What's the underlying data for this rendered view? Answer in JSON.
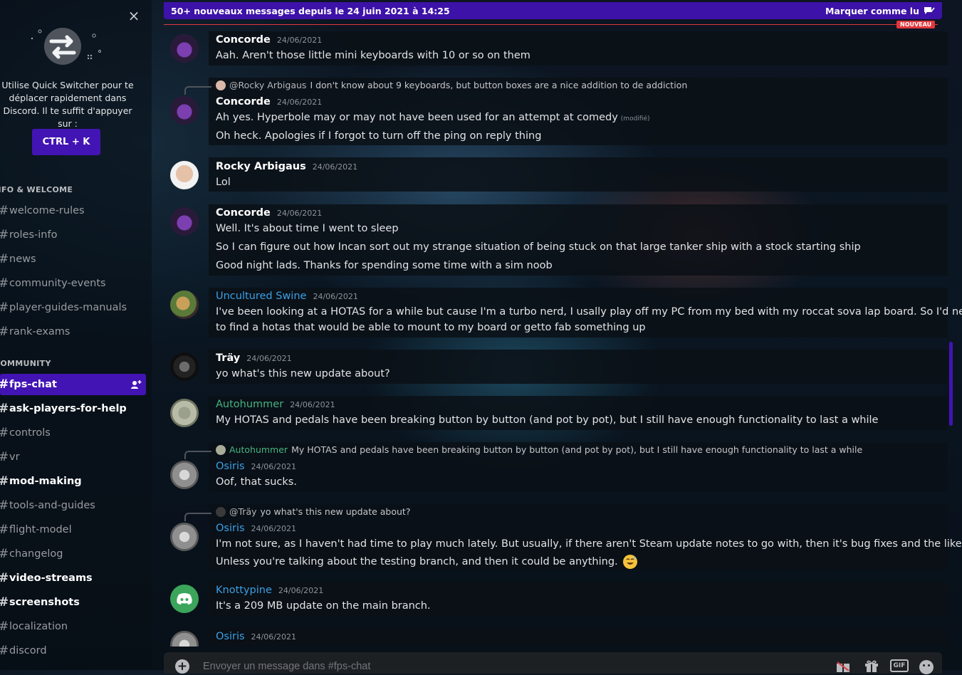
{
  "sidebar": {
    "close_glyph": "×",
    "quick_switcher_text": "Utilise Quick Switcher pour te déplacer rapidement dans Discord. Il te suffit d'appuyer sur :",
    "shortcut_button": "CTRL + K",
    "categories": [
      {
        "label": "INFO & WELCOME"
      },
      {
        "label": "COMMUNITY"
      }
    ],
    "channels": [
      {
        "name": "welcome-rules",
        "bold": false
      },
      {
        "name": "roles-info",
        "bold": false
      },
      {
        "name": "news",
        "bold": false
      },
      {
        "name": "community-events",
        "bold": false
      },
      {
        "name": "player-guides-manuals",
        "bold": false
      },
      {
        "name": "rank-exams",
        "bold": false
      },
      {
        "name": "fps-chat",
        "active": true
      },
      {
        "name": "ask-players-for-help",
        "bold": true
      },
      {
        "name": "controls",
        "bold": false
      },
      {
        "name": "vr",
        "bold": false
      },
      {
        "name": "mod-making",
        "bold": true
      },
      {
        "name": "tools-and-guides",
        "bold": false
      },
      {
        "name": "flight-model",
        "bold": false
      },
      {
        "name": "changelog",
        "bold": false
      },
      {
        "name": "video-streams",
        "bold": true
      },
      {
        "name": "screenshots",
        "bold": true
      },
      {
        "name": "localization",
        "bold": false
      },
      {
        "name": "discord",
        "bold": false
      }
    ]
  },
  "banner": {
    "text": "50+ nouveaux messages depuis le 24 juin 2021 à 14:25",
    "mark_read": "Marquer comme lu"
  },
  "new_badge": "NOUVEAU",
  "messages": [
    {
      "author": "Concorde",
      "timestamp": "24/06/2021",
      "lines": [
        "Aah. Aren't those little mini keyboards with 10 or so on them"
      ]
    },
    {
      "reply": {
        "name": "@Rocky Arbigaus",
        "text": "I don't know about 9 keyboards, but button boxes are a nice addition to de addiction"
      },
      "author": "Concorde",
      "timestamp": "24/06/2021",
      "lines": [
        "Ah yes. Hyperbole may or may not have been used for an attempt at comedy",
        "Oh heck. Apologies if I forgot to turn off the ping on reply thing"
      ],
      "edited": "(modifié)"
    },
    {
      "author": "Rocky Arbigaus",
      "timestamp": "24/06/2021",
      "lines": [
        "Lol"
      ]
    },
    {
      "author": "Concorde",
      "timestamp": "24/06/2021",
      "lines": [
        "Well. It's about time I went to sleep",
        "So I can figure out how Incan sort out my strange situation of being stuck on that large tanker ship with a stock starting ship",
        "Good night lads. Thanks for spending some time with a sim noob"
      ]
    },
    {
      "author": "Uncultured Swine",
      "timestamp": "24/06/2021",
      "lines": [
        "I've been looking at a HOTAS for a while but cause I'm a turbo nerd, I usally play off my PC from my bed with my roccat sova lap board. So I'd need",
        "to find a hotas that would be able to mount to my board or getto fab something up"
      ]
    },
    {
      "author": "Träy",
      "timestamp": "24/06/2021",
      "lines": [
        "yo what's this new update about?"
      ]
    },
    {
      "author": "Autohummer",
      "timestamp": "24/06/2021",
      "lines": [
        "My HOTAS and pedals have been breaking button by button (and pot by pot), but I still have enough functionality to last a while"
      ]
    },
    {
      "reply": {
        "name": "Autohummer",
        "text": "My HOTAS and pedals have been breaking button by button (and pot by pot), but I still have enough functionality to last a while"
      },
      "author": "Osiris",
      "timestamp": "24/06/2021",
      "lines": [
        "Oof, that sucks."
      ]
    },
    {
      "reply": {
        "name": "@Träy",
        "text": "yo what's this new update about?"
      },
      "author": "Osiris",
      "timestamp": "24/06/2021",
      "lines": [
        "I'm not sure, as I haven't had time to play much lately.  But usually, if there aren't Steam update notes to go with, then it's bug fixes and the like.",
        "Unless you're talking about the testing branch, and then it could be anything."
      ]
    },
    {
      "author": "Knottypine",
      "timestamp": "24/06/2021",
      "lines": [
        "It's a 209 MB update on the main branch."
      ]
    },
    {
      "author": "Osiris",
      "timestamp": "24/06/2021",
      "lines": []
    }
  ],
  "composer": {
    "plus": "+",
    "placeholder": "Envoyer un message dans #fps-chat",
    "gif_label": "GIF"
  },
  "colors": {
    "accent": "#4214b4",
    "new_red": "#e0383d",
    "name_blue": "#3aa0e6",
    "name_green": "#43b581",
    "discord_green": "#3ba55c"
  },
  "icons": [
    "close-icon",
    "quick-switcher-arrows-icon",
    "add-member-icon",
    "mark-read-icon",
    "plus-icon",
    "gift-icon",
    "gif-icon",
    "emoji-icon",
    "sweat-smile-emoji",
    "discord-logo-icon"
  ]
}
